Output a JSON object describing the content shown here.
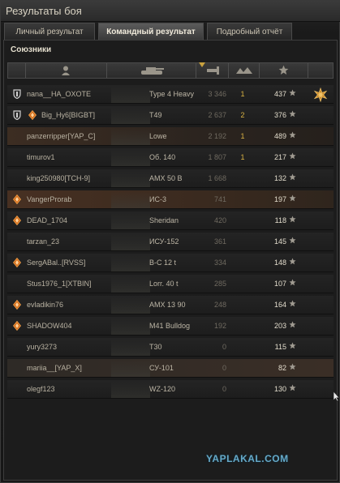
{
  "window": {
    "title": "Результаты боя"
  },
  "tabs": [
    {
      "label": "Личный результат"
    },
    {
      "label": "Командный результат"
    },
    {
      "label": "Подробный отчёт"
    }
  ],
  "section": {
    "title": "Союзники"
  },
  "colors": {
    "kills": "#d9b243",
    "xp": "#e2dccc",
    "highlight": "#3c2d22",
    "watermark": "#66a9c8"
  },
  "header_icons": [
    "player-icon",
    "tank-icon",
    "sort-arrow-icon",
    "damage-icon",
    "kills-icon",
    "xp-star-icon"
  ],
  "players": [
    {
      "name": "nana__HA_OXOTE",
      "tank": "Type 4 Heavy",
      "damage": "3 346",
      "kills": "1",
      "xp": "437",
      "icons": [
        "shield"
      ],
      "medal": true,
      "style": ""
    },
    {
      "name": "Big_Hy6[BIGBT]",
      "tank": "T49",
      "damage": "2 637",
      "kills": "2",
      "xp": "376",
      "icons": [
        "shield",
        "diamond"
      ],
      "medal": false,
      "style": ""
    },
    {
      "name": "panzerripper[YAP_C]",
      "tank": "Lowe",
      "damage": "2 192",
      "kills": "1",
      "xp": "489",
      "icons": [],
      "medal": false,
      "style": "hl"
    },
    {
      "name": "timurov1",
      "tank": "Об. 140",
      "damage": "1 807",
      "kills": "1",
      "xp": "217",
      "icons": [],
      "medal": false,
      "style": ""
    },
    {
      "name": "king250980[TCH-9]",
      "tank": "AMX 50 B",
      "damage": "1 668",
      "kills": "",
      "xp": "132",
      "icons": [],
      "medal": false,
      "style": ""
    },
    {
      "name": "VangerProrab",
      "tank": "ИС-3",
      "damage": "741",
      "kills": "",
      "xp": "197",
      "icons": [
        "diamond"
      ],
      "medal": false,
      "style": "hl2"
    },
    {
      "name": "DEAD_1704",
      "tank": "Sheridan",
      "damage": "420",
      "kills": "",
      "xp": "118",
      "icons": [
        "diamond"
      ],
      "medal": false,
      "style": ""
    },
    {
      "name": "tarzan_23",
      "tank": "ИСУ-152",
      "damage": "361",
      "kills": "",
      "xp": "145",
      "icons": [],
      "medal": false,
      "style": ""
    },
    {
      "name": "SergABal..[RVSS]",
      "tank": "B-C 12 t",
      "damage": "334",
      "kills": "",
      "xp": "148",
      "icons": [
        "diamond"
      ],
      "medal": false,
      "style": ""
    },
    {
      "name": "Stus1976_1[XTBIN]",
      "tank": "Lorr. 40 t",
      "damage": "285",
      "kills": "",
      "xp": "107",
      "icons": [],
      "medal": false,
      "style": ""
    },
    {
      "name": "evladikin76",
      "tank": "AMX 13 90",
      "damage": "248",
      "kills": "",
      "xp": "164",
      "icons": [
        "diamond"
      ],
      "medal": false,
      "style": ""
    },
    {
      "name": "SHADOW404",
      "tank": "M41 Bulldog",
      "damage": "192",
      "kills": "",
      "xp": "203",
      "icons": [
        "diamond"
      ],
      "medal": false,
      "style": ""
    },
    {
      "name": "yury3273",
      "tank": "T30",
      "damage": "0",
      "kills": "",
      "xp": "115",
      "icons": [],
      "medal": false,
      "style": ""
    },
    {
      "name": "mariia__[YAP_X]",
      "tank": "СУ-101",
      "damage": "0",
      "kills": "",
      "xp": "82",
      "icons": [],
      "medal": false,
      "style": "sel"
    },
    {
      "name": "olegf123",
      "tank": "WZ-120",
      "damage": "0",
      "kills": "",
      "xp": "130",
      "icons": [],
      "medal": false,
      "style": ""
    }
  ],
  "watermark": "YAPLAKAL.COM"
}
